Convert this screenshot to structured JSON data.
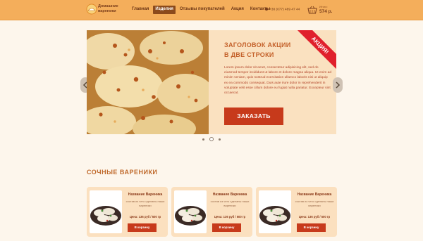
{
  "logo": {
    "line1": "Домашние",
    "line2": "вареники"
  },
  "nav": [
    {
      "label": "Главная"
    },
    {
      "label": "Изделия",
      "active": true
    },
    {
      "label": "Отзывы покупателей"
    },
    {
      "label": "Акция"
    },
    {
      "label": "Контакты"
    }
  ],
  "phone": "+38 (077) 489 47 44",
  "cart": {
    "label": "Итого:",
    "sum": "574 р."
  },
  "slider": {
    "title_line1": "ЗАГОЛОВОК АКЦИИ",
    "title_line2": "В ДВЕ СТРОКИ",
    "text": "Lorem ipsum dolor sit amet, consectetur adipisicing elit, sed do eiusmod tempor incididunt ut labore et dolore magna aliqua. Ut enim ad minim veniam, quis nostrud exercitation ullamco laboris nisi ut aliquip ex ea commodo consequat. Duis aute irure dolor in reprehenderit in voluptate velit esse cillum dolore eu fugiat nulla pariatur. Excepteur sint occaecat.",
    "button": "ЗАКАЗАТЬ",
    "badge": "АКЦИЯ!"
  },
  "section_title": "СОЧНЫЕ ВАРЕНИКИ",
  "cards": [
    {
      "title": "Название Вареника",
      "desc": "состав из чего сделаны наши вареники",
      "price": "Цена: 136 руб / 500 гр",
      "button": "В корзину"
    },
    {
      "title": "Название Вареника",
      "desc": "состав из чего сделаны наши вареники",
      "price": "Цена: 136 руб / 500 гр",
      "button": "В корзину"
    },
    {
      "title": "Название Вареника",
      "desc": "состав из чего сделаны наши вареники",
      "price": "Цена: 136 руб / 500 гр",
      "button": "В корзину"
    }
  ],
  "colors": {
    "header": "#f4ae5b",
    "accent": "#c73a1b",
    "badge": "#e0202c",
    "panel": "#fae1c0"
  },
  "icons": [
    "logo-icon",
    "phone-icon",
    "cart-icon",
    "arrow-left-icon",
    "arrow-right-icon"
  ]
}
